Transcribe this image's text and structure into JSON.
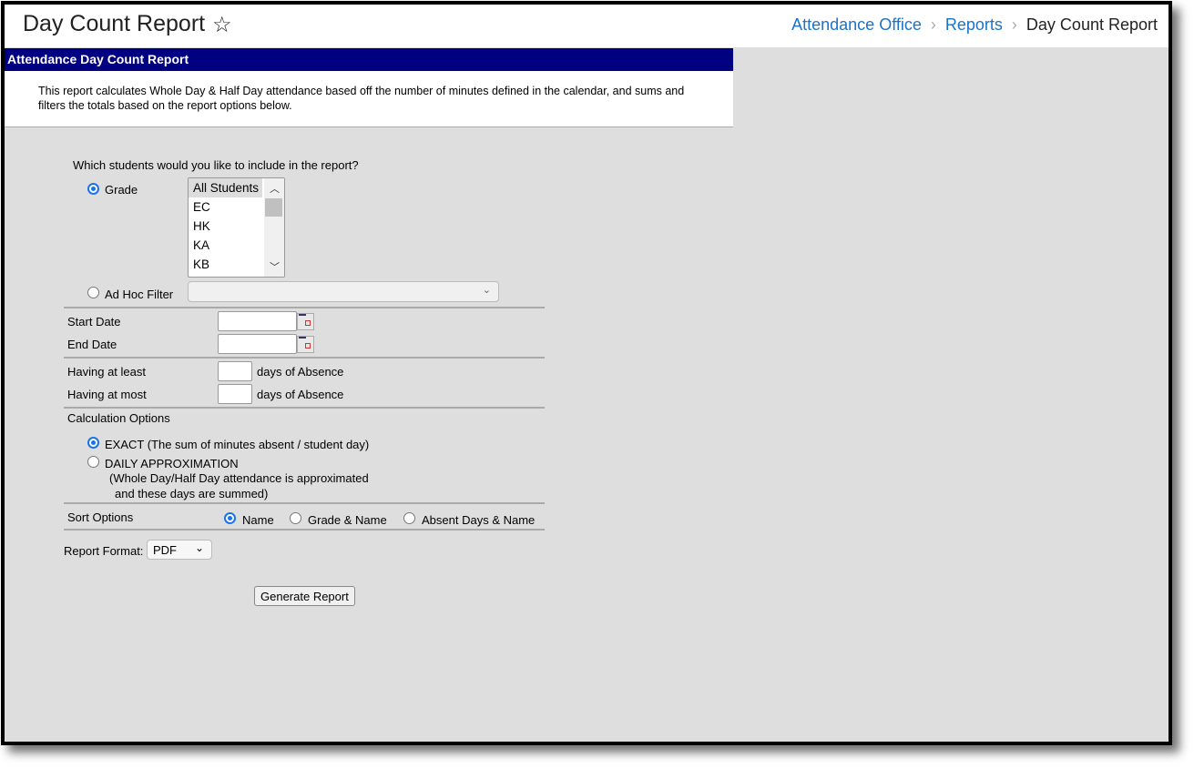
{
  "header": {
    "title": "Day Count Report",
    "favorite_icon": "star-outline-icon",
    "breadcrumb": [
      {
        "label": "Attendance Office"
      },
      {
        "label": "Reports"
      },
      {
        "label": "Day Count Report"
      }
    ]
  },
  "panel": {
    "title": "Attendance Day Count Report",
    "description": "This report calculates Whole Day & Half Day attendance based off the number of minutes defined in the calendar, and sums and filters the totals based on the report options below."
  },
  "form": {
    "students_question": "Which students would you like to include in the report?",
    "grade_label": "Grade",
    "grade_selected": true,
    "grade_options": [
      "All Students",
      "EC",
      "HK",
      "KA",
      "KB"
    ],
    "grade_selected_option": "All Students",
    "adhoc_label": "Ad Hoc Filter",
    "adhoc_value": "",
    "start_date_label": "Start Date",
    "start_date_value": "",
    "end_date_label": "End Date",
    "end_date_value": "",
    "at_least_label": "Having at least",
    "at_least_value": "",
    "at_least_suffix": "days of Absence",
    "at_most_label": "Having at most",
    "at_most_value": "",
    "at_most_suffix": "days of Absence",
    "calc_label": "Calculation Options",
    "calc_exact": "EXACT (The sum of minutes absent / student day)",
    "calc_daily": "DAILY APPROXIMATION",
    "calc_daily_note1": "(Whole Day/Half Day attendance is approximated",
    "calc_daily_note2": "and these days are summed)",
    "calc_selected": "EXACT",
    "sort_label": "Sort Options",
    "sort_options": [
      "Name",
      "Grade & Name",
      "Absent Days & Name"
    ],
    "sort_selected": "Name",
    "format_label": "Report Format:",
    "format_value": "PDF",
    "generate_label": "Generate Report"
  },
  "colors": {
    "panel_header": "#000080",
    "link": "#1a73c8",
    "radio_selected": "#1a73e8",
    "background": "#dedede"
  }
}
